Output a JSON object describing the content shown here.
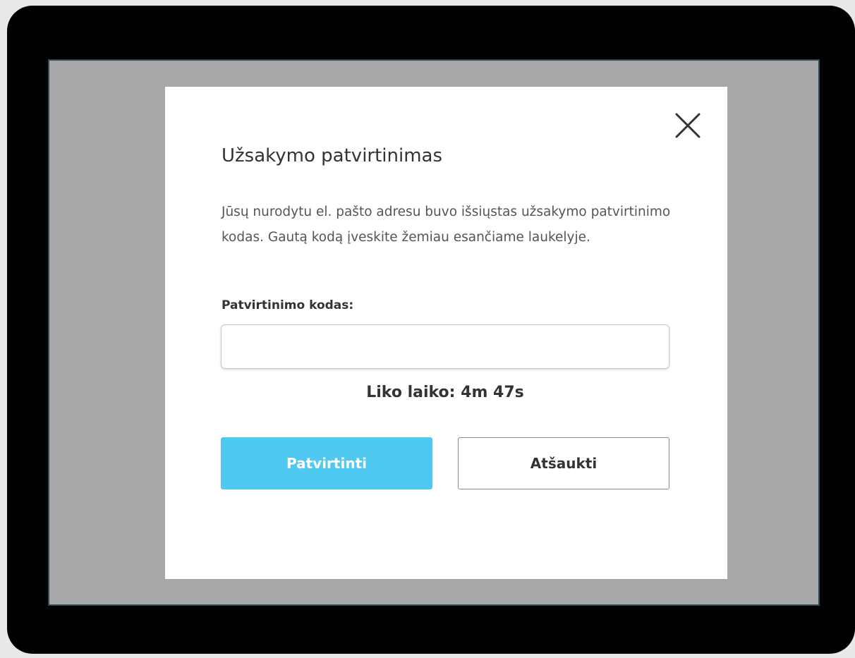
{
  "modal": {
    "title": "Užsakymo patvirtinimas",
    "description": "Jūsų nurodytu el. pašto adresu buvo išsiųstas užsakymo patvirtinimo kodas. Gautą kodą įveskite žemiau esančiame laukelyje.",
    "close_icon": "close-icon"
  },
  "form": {
    "code_label": "Patvirtinimo kodas:",
    "code_value": "",
    "code_placeholder": ""
  },
  "timer": {
    "label": "Liko laiko:",
    "value": "4m 47s"
  },
  "actions": {
    "confirm_label": "Patvirtinti",
    "cancel_label": "Atšaukti"
  },
  "colors": {
    "primary_button": "#4fc9f0",
    "overlay": "#a8a8a8",
    "device_frame": "#000000"
  }
}
